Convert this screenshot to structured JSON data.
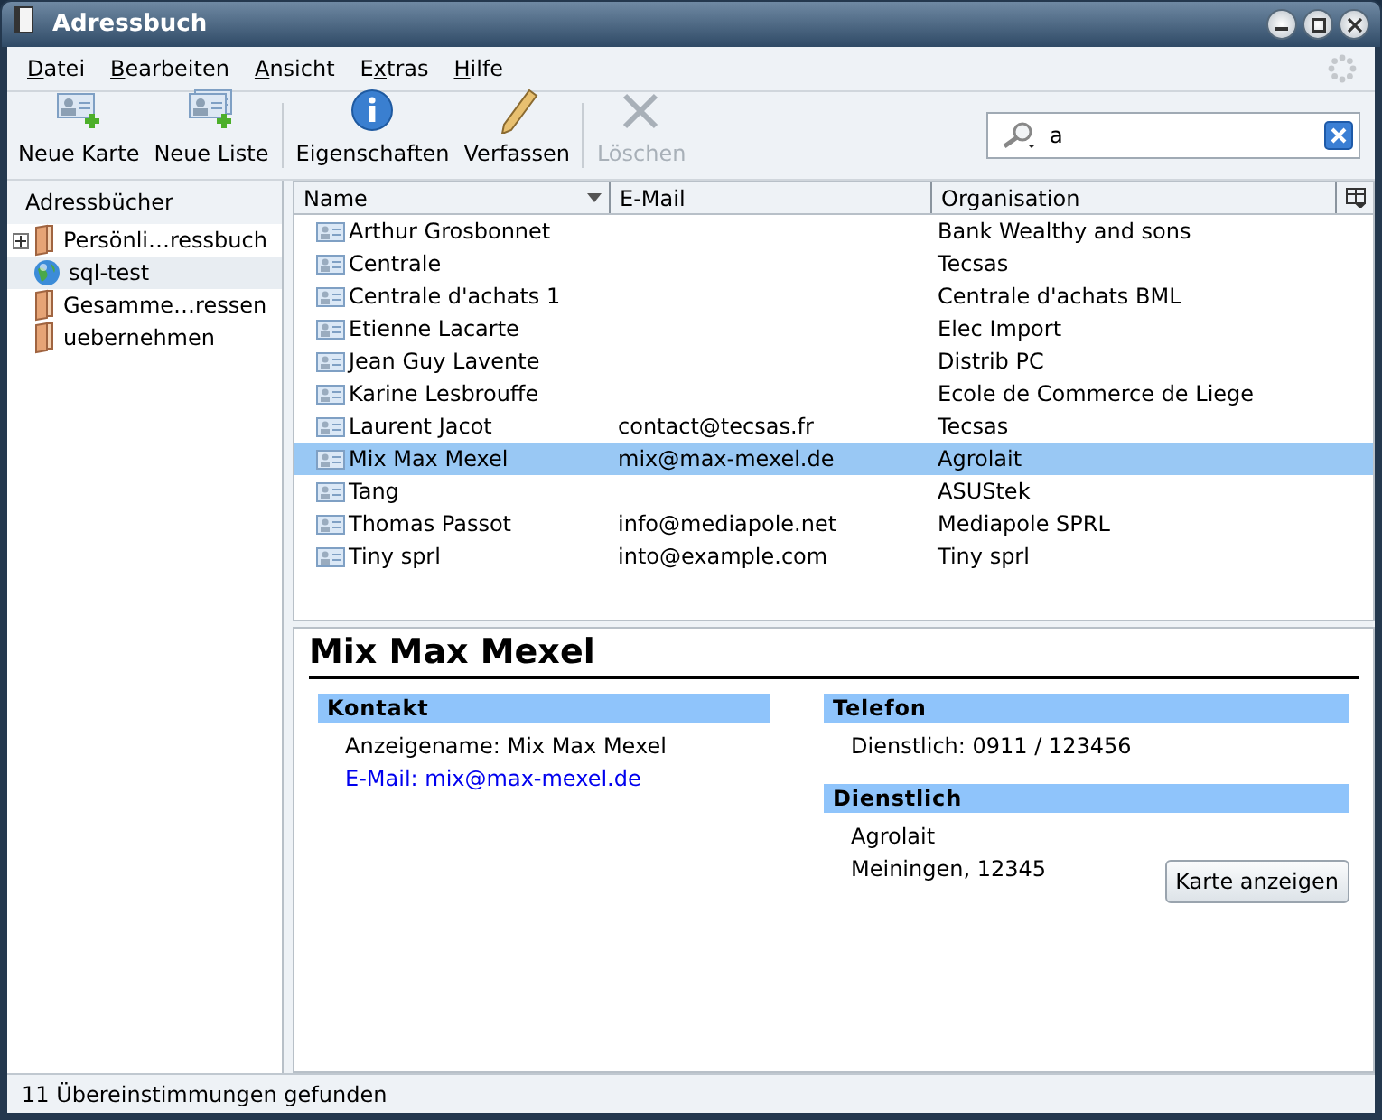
{
  "window": {
    "title": "Adressbuch"
  },
  "menu": [
    {
      "mnemonic": "D",
      "after": "atei"
    },
    {
      "mnemonic": "B",
      "after": "earbeiten"
    },
    {
      "mnemonic": "A",
      "after": "nsicht"
    },
    {
      "before": "E",
      "mnemonic": "x",
      "after": "tras"
    },
    {
      "mnemonic": "H",
      "after": "ilfe"
    }
  ],
  "toolbar": [
    {
      "label": "Neue Karte",
      "kind": "new-card",
      "disabled": false
    },
    {
      "label": "Neue Liste",
      "kind": "new-list",
      "disabled": false
    },
    {
      "kind": "separator"
    },
    {
      "label": "Eigenschaften",
      "kind": "info",
      "disabled": false
    },
    {
      "label": "Verfassen",
      "kind": "pencil",
      "disabled": false
    },
    {
      "kind": "separator"
    },
    {
      "label": "Löschen",
      "kind": "delete",
      "disabled": true
    }
  ],
  "search": {
    "value": "a"
  },
  "sidebar": {
    "title": "Adressbücher",
    "items": [
      {
        "label": "Persönli…ressbuch",
        "kind": "book",
        "expandable": true,
        "selected": false
      },
      {
        "label": "sql-test",
        "kind": "globe",
        "expandable": false,
        "selected": true
      },
      {
        "label": "Gesamme…ressen",
        "kind": "book",
        "expandable": false,
        "selected": false
      },
      {
        "label": "uebernehmen",
        "kind": "book",
        "expandable": false,
        "selected": false
      }
    ]
  },
  "table": {
    "columns": [
      {
        "label": "Name",
        "sorted": true
      },
      {
        "label": "E-Mail",
        "sorted": false
      },
      {
        "label": "Organisation",
        "sorted": false
      }
    ],
    "rows": [
      {
        "name": "Arthur Grosbonnet",
        "org": "Bank Wealthy and sons",
        "selected": false
      },
      {
        "name": "Centrale",
        "org": "Tecsas",
        "selected": false
      },
      {
        "name": "Centrale d'achats 1",
        "org": "Centrale d'achats BML",
        "selected": false
      },
      {
        "name": "Etienne Lacarte",
        "org": "Elec Import",
        "selected": false
      },
      {
        "name": "Jean Guy Lavente",
        "org": "Distrib PC",
        "selected": false
      },
      {
        "name": "Karine Lesbrouffe",
        "org": "Ecole de Commerce de Liege",
        "selected": false
      },
      {
        "name": "Laurent Jacot",
        "email": "contact@tecsas.fr",
        "org": "Tecsas",
        "selected": false
      },
      {
        "name": "Mix Max Mexel",
        "email": "mix@max-mexel.de",
        "org": "Agrolait",
        "selected": true
      },
      {
        "name": "Tang",
        "org": "ASUStek",
        "selected": false
      },
      {
        "name": "Thomas Passot",
        "email": "info@mediapole.net",
        "org": "Mediapole SPRL",
        "selected": false
      },
      {
        "name": "Tiny sprl",
        "email": "into@example.com",
        "org": "Tiny sprl",
        "selected": false
      }
    ]
  },
  "detail": {
    "name": "Mix Max Mexel",
    "contact": {
      "title": "Kontakt",
      "display_name": "Anzeigename: Mix Max Mexel",
      "email": "E-Mail: mix@max-mexel.de"
    },
    "phone": {
      "title": "Telefon",
      "lines": [
        "Dienstlich: 0911 / 123456"
      ]
    },
    "work": {
      "title": "Dienstlich",
      "lines": [
        "Agrolait",
        "Meiningen, 12345"
      ],
      "button": "Karte anzeigen"
    }
  },
  "status_bar": "11 Übereinstimmungen gefunden"
}
